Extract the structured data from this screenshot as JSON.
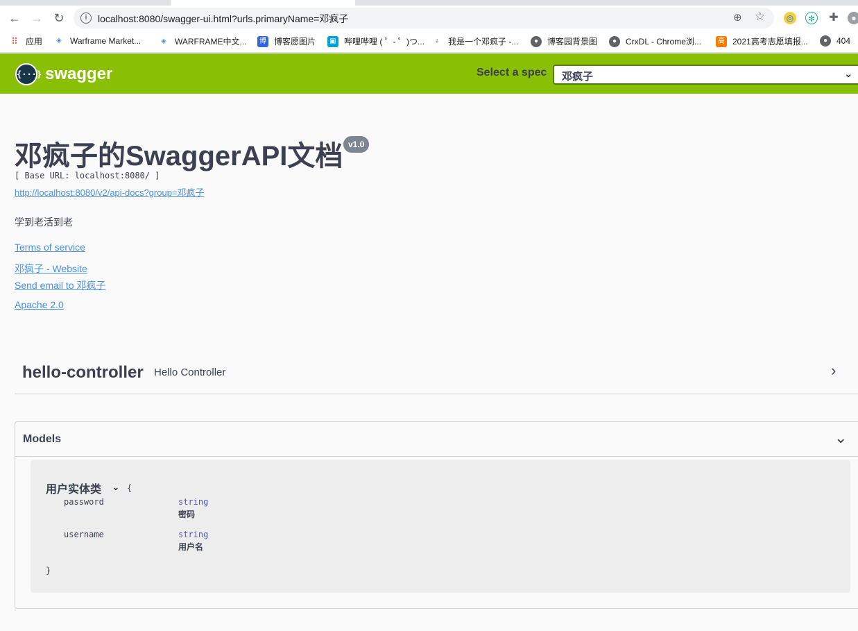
{
  "browser": {
    "url": "localhost:8080/swagger-ui.html?urls.primaryName=邓疯子",
    "bookmarks": [
      {
        "label": "应用",
        "icon": "apps-grid-icon",
        "color": "#e94235"
      },
      {
        "label": "Warframe Market...",
        "icon": "warframe-icon",
        "color": "#4a90c4"
      },
      {
        "label": "WARFRAME中文...",
        "icon": "warframe-icon",
        "color": "#4a90c4"
      },
      {
        "label": "博客愿图片",
        "icon": "blog-icon",
        "color": "#3367d6"
      },
      {
        "label": "哔哩哔哩 ( ゜- ゜)つ...",
        "icon": "bilibili-icon",
        "color": "#00a1d6"
      },
      {
        "label": "我是一个邓疯子 -...",
        "icon": "person-icon",
        "color": "#444444"
      },
      {
        "label": "博客园背景图",
        "icon": "globe-icon",
        "color": "#5f6368"
      },
      {
        "label": "CrxDL - Chrome浏...",
        "icon": "globe-icon",
        "color": "#5f6368"
      },
      {
        "label": "2021高考志愿填报...",
        "icon": "gaokao-icon",
        "color": "#f57c00"
      },
      {
        "label": "404",
        "icon": "globe-icon",
        "color": "#5f6368"
      }
    ]
  },
  "topbar": {
    "logo_symbol": "{···}",
    "logo_text": "swagger",
    "spec_label": "Select a spec",
    "spec_value": "邓疯子"
  },
  "info": {
    "title": "邓疯子的SwaggerAPI文档",
    "version": "v1.0",
    "base_url": "[ Base URL: localhost:8080/ ]",
    "doc_link": "http://localhost:8080/v2/api-docs?group=邓疯子",
    "description": "学到老活到老",
    "terms": "Terms of service",
    "website": "邓疯子 - Website",
    "email": "Send email to 邓疯子",
    "license": "Apache 2.0"
  },
  "controller": {
    "name": "hello-controller",
    "description": "Hello Controller"
  },
  "models": {
    "title": "Models",
    "model": {
      "name": "用户实体类",
      "open_brace": "{",
      "close_brace": "}",
      "properties": [
        {
          "name": "password",
          "type": "string",
          "description": "密码"
        },
        {
          "name": "username",
          "type": "string",
          "description": "用户名"
        }
      ]
    }
  }
}
